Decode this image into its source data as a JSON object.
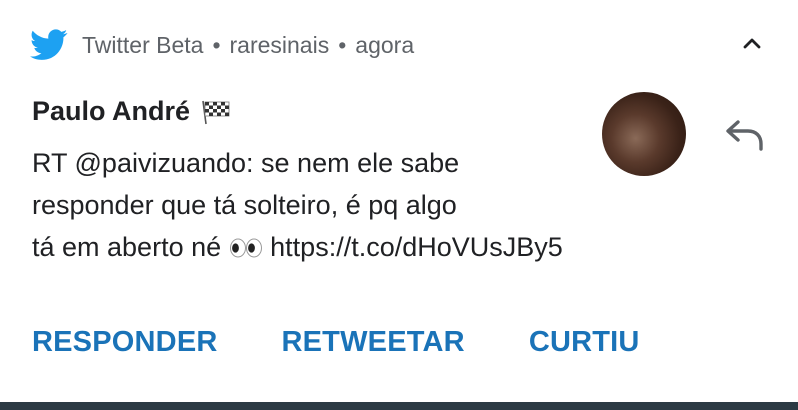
{
  "header": {
    "app_name": "Twitter Beta",
    "account": "raresinais",
    "time": "agora",
    "separator": "•"
  },
  "notification": {
    "sender": "Paulo André",
    "message_lines": [
      "RT @paivizuando: se nem ele sabe",
      "responder que tá solteiro, é pq algo",
      "tá em aberto né",
      "https://t.co/dHoVUsJBy5"
    ]
  },
  "actions": {
    "reply_label": "RESPONDER",
    "retweet_label": "RETWEETAR",
    "like_label": "CURTIU"
  },
  "colors": {
    "accent": "#1a73b8",
    "twitter_blue": "#1da1f2",
    "bottom_bar": "#2c3a44"
  },
  "icons": {
    "app": "twitter-bird-icon",
    "collapse": "chevron-up-icon",
    "reply": "reply-arrow-icon",
    "flag": "checkered-flag-icon",
    "emoji": "eyes-emoji-icon"
  }
}
